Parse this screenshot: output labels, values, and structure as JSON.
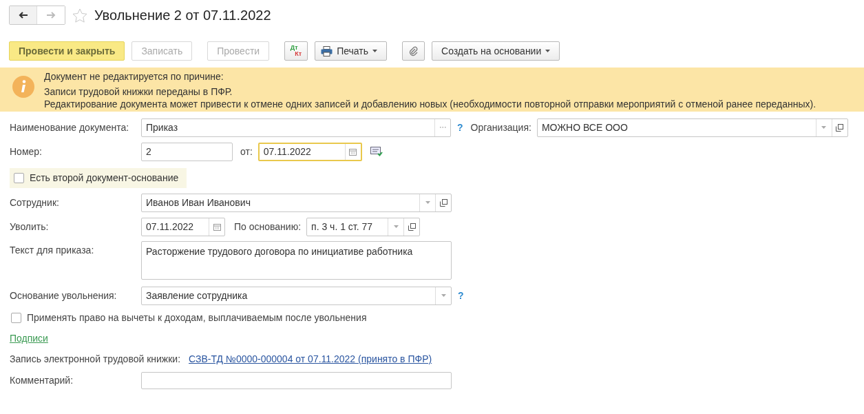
{
  "nav": {
    "back_enabled": true,
    "forward_enabled": false
  },
  "title": "Увольнение 2 от 07.11.2022",
  "favorite": false,
  "toolbar": [
    {
      "kind": "primary",
      "label": "Провести и закрыть",
      "disabled": false
    },
    {
      "kind": "button",
      "label": "Записать",
      "disabled": true
    },
    {
      "kind": "button",
      "label": "Провести",
      "disabled": true
    },
    {
      "kind": "dtkt",
      "top": "Дт",
      "bottom": "Кт"
    },
    {
      "kind": "print",
      "label": "Печать"
    },
    {
      "kind": "attach"
    },
    {
      "kind": "menu",
      "label": "Создать на основании"
    }
  ],
  "banner": {
    "heading": "Документ не редактируется по причине:",
    "lines": [
      "Записи трудовой книжки переданы в ПФР.",
      "Редактирование документа может привести к отмене одних записей и добавлению новых (необходимости повторной отправки мероприятий с отменой ранее переданных)."
    ]
  },
  "document_name": {
    "label": "Наименование документа:",
    "value": "Приказ",
    "help": "?"
  },
  "organization": {
    "label": "Организация:",
    "value": "МОЖНО ВСЕ ООО"
  },
  "number": {
    "label": "Номер:",
    "value": "2"
  },
  "date": {
    "label": "от:",
    "value": "07.11.2022",
    "focused": true
  },
  "second_basis": {
    "label": "Есть второй документ-основание",
    "checked": false
  },
  "employee": {
    "label": "Сотрудник:",
    "value": "Иванов Иван Иванович"
  },
  "dismiss_date": {
    "label": "Уволить:",
    "value": "07.11.2022"
  },
  "legal_basis": {
    "label": "По основанию:",
    "value": "п. 3 ч. 1 ст. 77"
  },
  "order_text": {
    "label": "Текст для приказа:",
    "value": "Расторжение трудового договора по инициативе работника"
  },
  "dismissal_basis": {
    "label": "Основание увольнения:",
    "value": "Заявление сотрудника",
    "help": "?"
  },
  "deductions": {
    "label": "Применять право на вычеты к доходам, выплачиваемым после увольнения",
    "checked": false
  },
  "signatures_link": "Подписи",
  "record": {
    "label": "Запись электронной трудовой книжки:",
    "link": "СЗВ-ТД №0000-000004 от 07.11.2022 (принято в ПФР)"
  },
  "comment": {
    "label": "Комментарий:"
  }
}
